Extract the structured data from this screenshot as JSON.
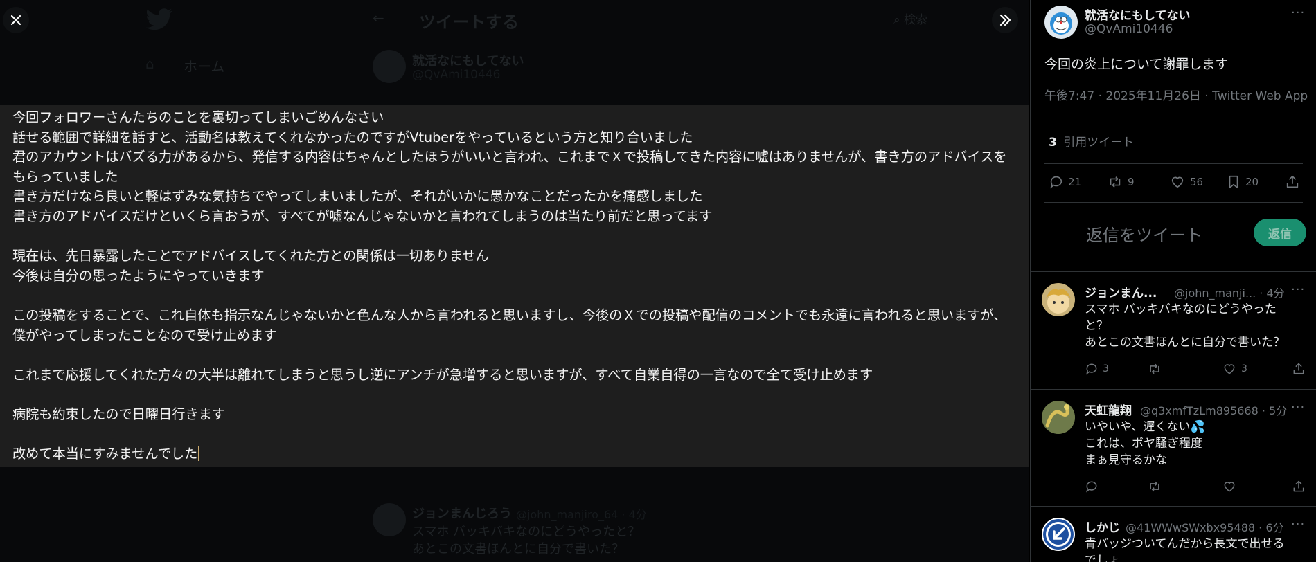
{
  "viewer": {
    "background": {
      "header_title": "ツイートする",
      "search_placeholder": "検索",
      "nav_home": "ホーム",
      "tweet_name": "就活なにもしてない",
      "tweet_handle": "@QvAmi10446",
      "reply_name": "ジョンまんじろう",
      "reply_handle": "@john_manjiro_64 · 4分",
      "reply_line1": "スマホ バッキバキなのにどうやったと？",
      "reply_line2": "あとこの文書ほんとに自分で書いた？"
    },
    "image_text": "今回フォロワーさんたちのことを裏切ってしまいごめんなさい\n話せる範囲で詳細を話すと、活動名は教えてくれなかったのですがVtuberをやっているという方と知り合いました\n君のアカウントはバズる力があるから、発信する内容はちゃんとしたほうがいいと言われ、これまでＸで投稿してきた内容に嘘はありませんが、書き方のアドバイスをもらっていました\n書き方だけなら良いと軽はずみな気持ちでやってしまいましたが、それがいかに愚かなことだったかを痛感しました\n書き方のアドバイスだけといくら言おうが、すべてが嘘なんじゃないかと言われてしまうのは当たり前だと思ってます\n\n現在は、先日暴露したことでアドバイスしてくれた方との関係は一切ありません\n今後は自分の思ったようにやっていきます\n\nこの投稿をすることで、これ自体も指示なんじゃないかと色んな人から言われると思いますし、今後のＸでの投稿や配信のコメントでも永遠に言われると思いますが、僕がやってしまったことなので受け止めます\n\nこれまで応援してくれた方々の大半は離れてしまうと思うし逆にアンチが急増すると思いますが、すべて自業自得の一言なので全て受け止めます\n\n病院も約束したので日曜日行きます\n\n改めて本当にすみませんでした",
    "close_icon": "close-icon",
    "expand_icon": "chevrons-right-icon"
  },
  "tweet": {
    "name": "就活なにもしてない",
    "handle": "@QvAmi10446",
    "text": "今回の炎上について謝罪します",
    "meta": "午後7:47 · 2025年11月26日 · Twitter Web App",
    "quote_count": "3",
    "quote_label": "引用ツイート",
    "actions": {
      "reply": "21",
      "retweet": "9",
      "like": "56",
      "bookmark": "20"
    }
  },
  "composer": {
    "placeholder": "返信をツイート",
    "button": "返信"
  },
  "replies": [
    {
      "name": "ジョンまん...",
      "meta": "@john_manji... · 4分",
      "text": "スマホ バッキバキなのにどうやった\nと？\nあとこの文書ほんとに自分で書いた？",
      "reply": "3",
      "retweet": "",
      "like": "3"
    },
    {
      "name": "天虹龍翔",
      "meta": "@q3xmfTzLm895668 · 5分",
      "text": "いやいや、遅くない💦\nこれは、ボヤ騒ぎ程度\nまぁ見守るかな",
      "reply": "",
      "retweet": "",
      "like": ""
    },
    {
      "name": "しかじ",
      "meta": "@41WWwSWxbx95488 · 6分",
      "text": "青バッジついてんだから長文で出せる\nでしょ",
      "reply": "",
      "retweet": "",
      "like": ""
    }
  ],
  "colors": {
    "accent_button": "#1a8f6f",
    "muted": "#71767b",
    "border": "#2f3336"
  }
}
